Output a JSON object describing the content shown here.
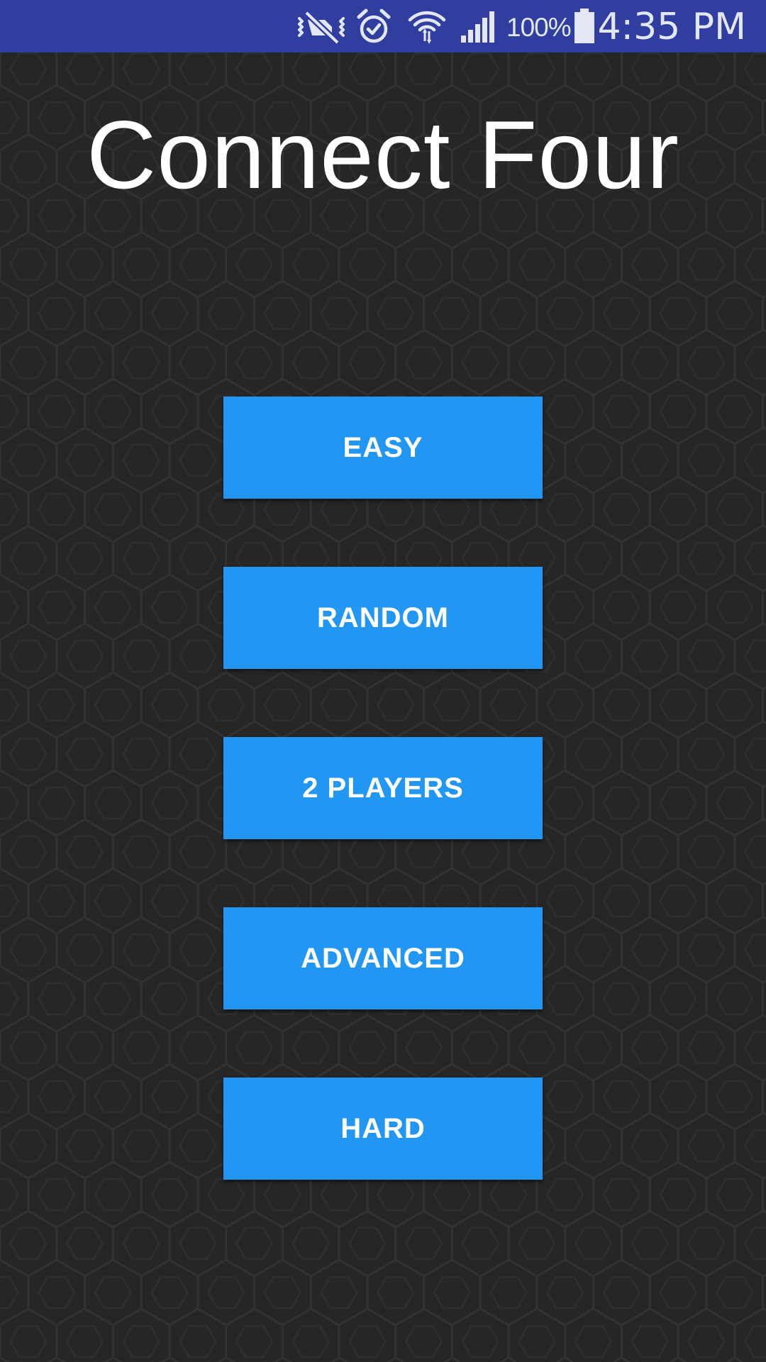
{
  "status_bar": {
    "battery_percent": "100%",
    "time": "4:35 PM",
    "icons": [
      "vibrate-mute-icon",
      "alarm-clock-icon",
      "wifi-data-icon",
      "cellular-signal-icon",
      "battery-icon"
    ]
  },
  "title": "Connect Four",
  "menu": {
    "buttons": [
      "EASY",
      "RANDOM",
      "2 PLAYERS",
      "ADVANCED",
      "HARD"
    ]
  },
  "colors": {
    "status_bar": "#303f9f",
    "background": "#262626",
    "button": "#2196f3",
    "button_text": "#ffffff"
  }
}
